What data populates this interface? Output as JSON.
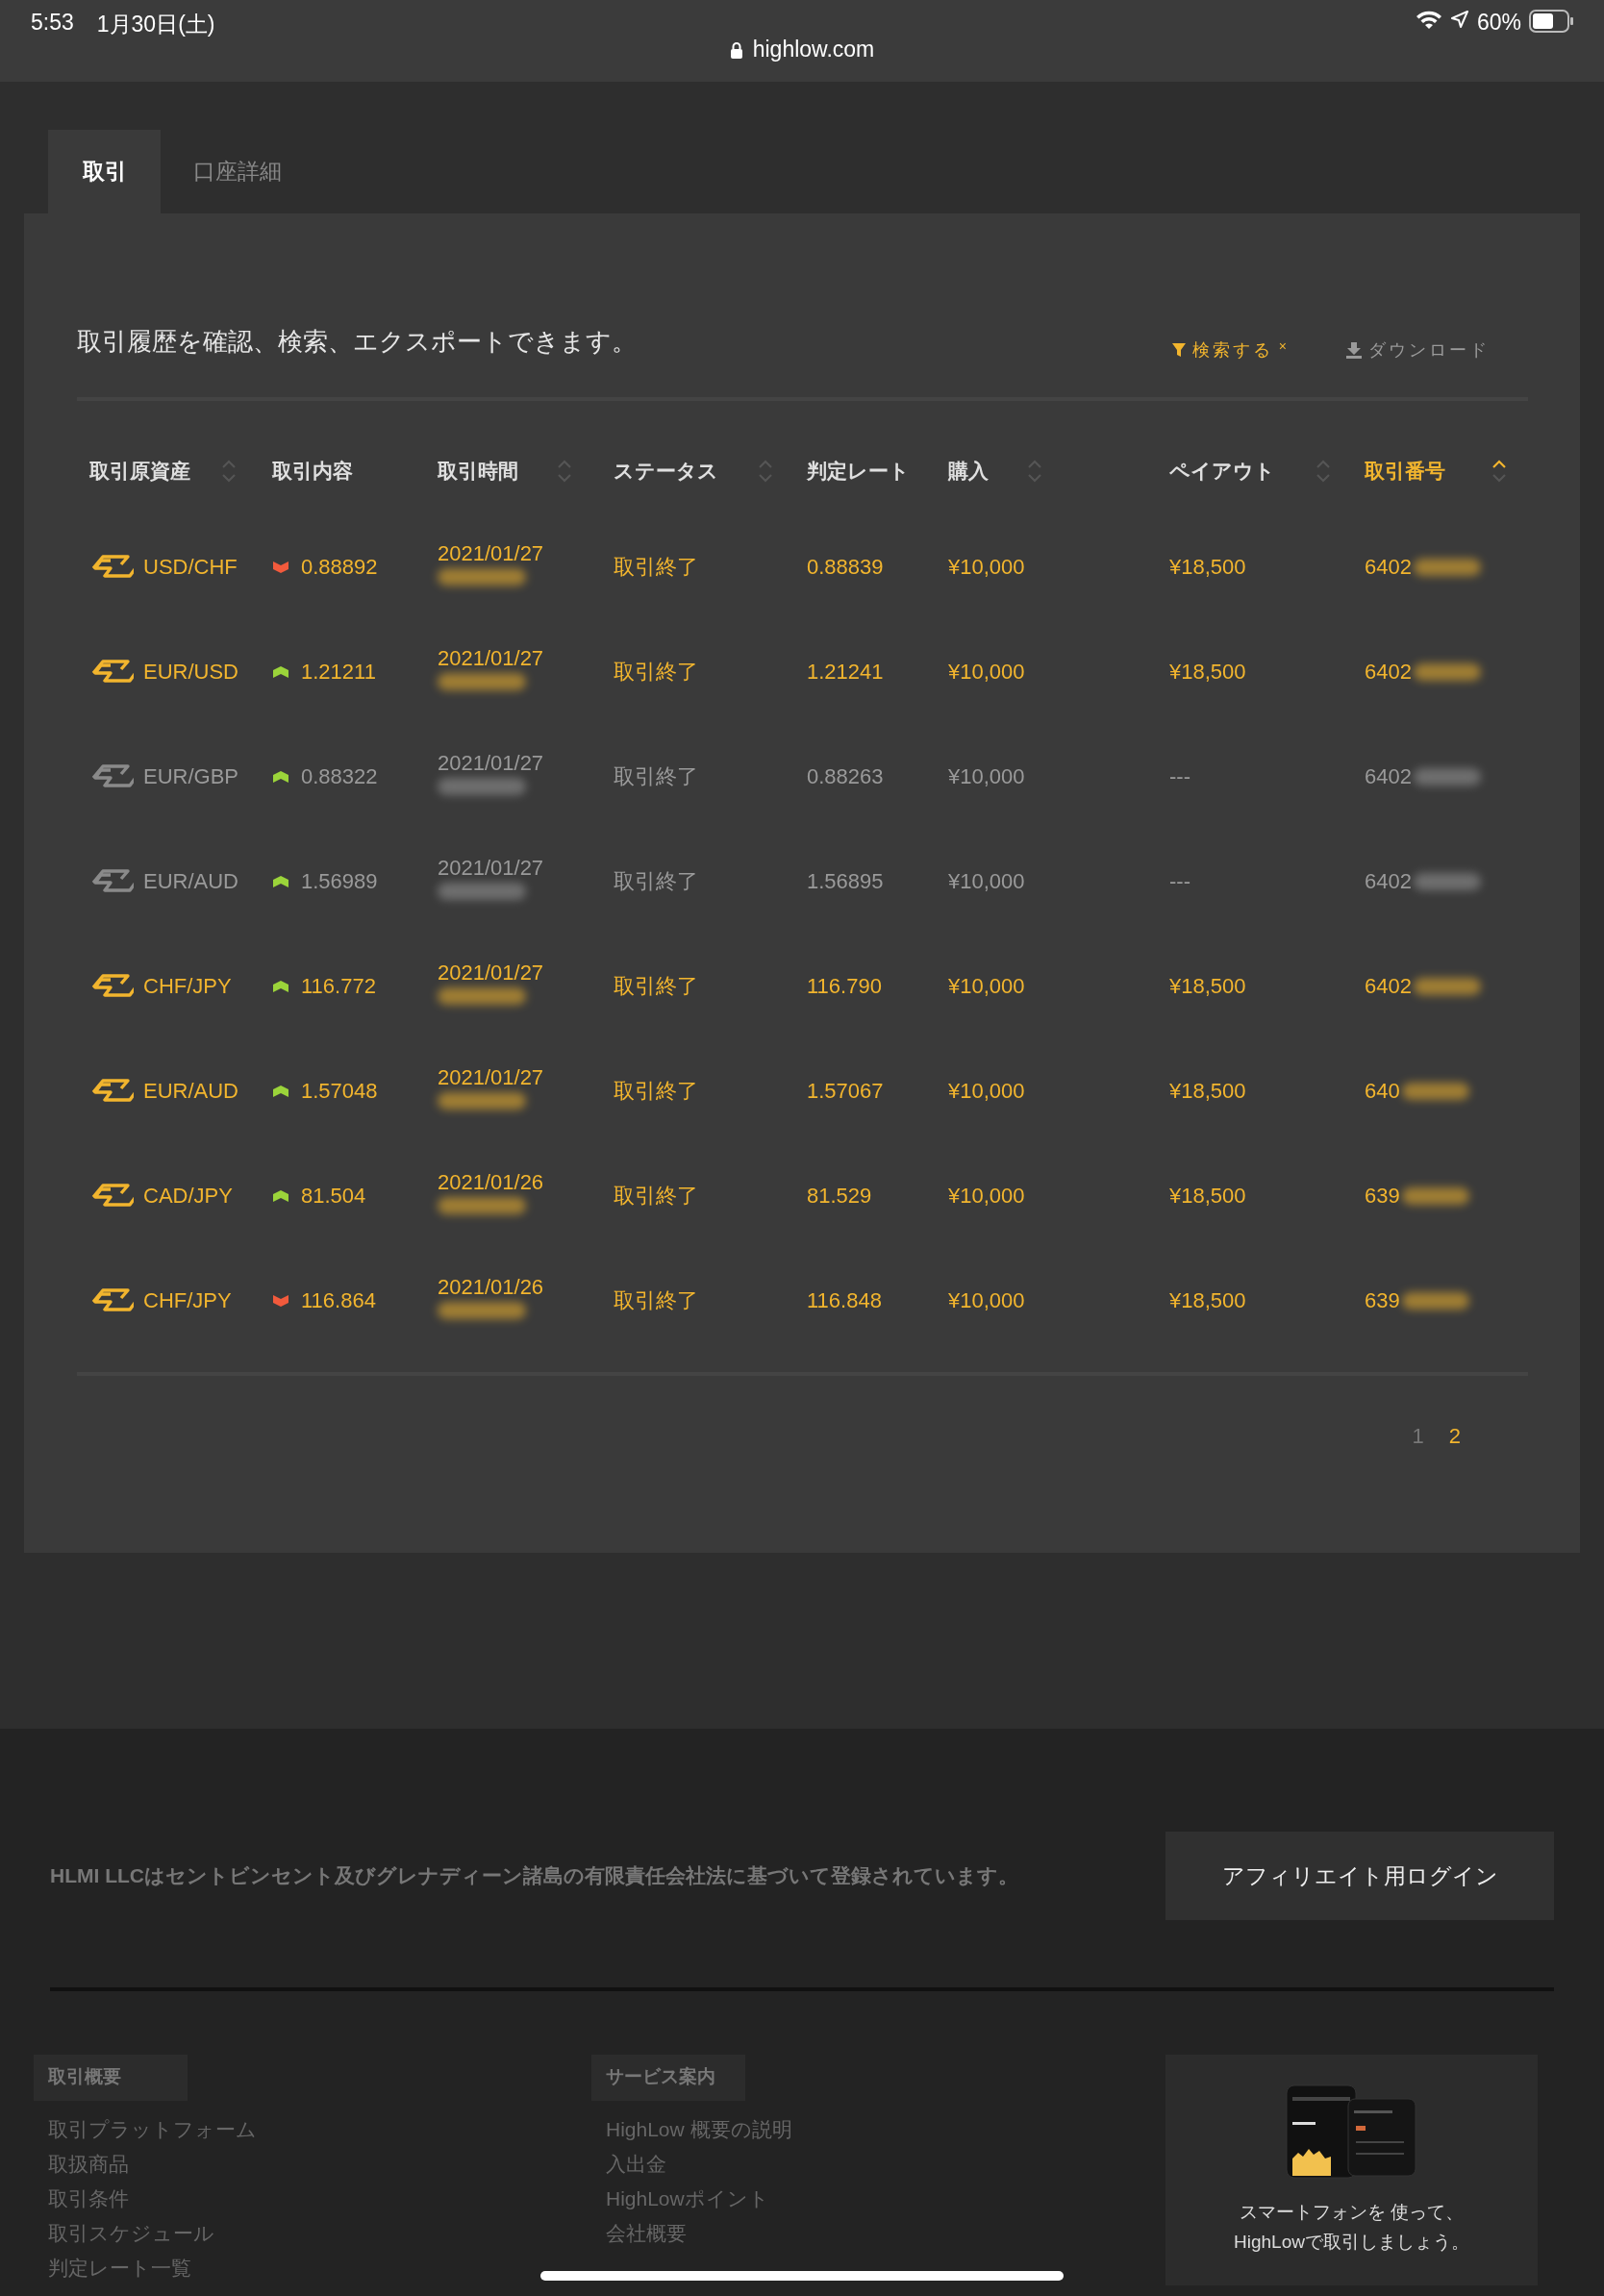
{
  "status_bar": {
    "time": "5:53",
    "date": "1月30日(土)",
    "url": "highlow.com",
    "battery": "60%"
  },
  "tabs": [
    {
      "label": "取引",
      "selected": true
    },
    {
      "label": "口座詳細",
      "selected": false
    }
  ],
  "panel": {
    "description": "取引履歴を確認、検索、エクスポートできます。",
    "actions": [
      {
        "kind": "filter",
        "label": "検索する",
        "clear": "×",
        "active": true
      },
      {
        "kind": "download",
        "label": "ダウンロード",
        "active": false
      }
    ]
  },
  "table": {
    "columns": [
      {
        "label": "取引原資産",
        "sortable": true,
        "sorted": false
      },
      {
        "label": "取引内容",
        "sortable": false,
        "sorted": false
      },
      {
        "label": "取引時間",
        "sortable": true,
        "sorted": false
      },
      {
        "label": "ステータス",
        "sortable": true,
        "sorted": false
      },
      {
        "label": "判定レート",
        "sortable": false,
        "sorted": false
      },
      {
        "label": "購入",
        "sortable": true,
        "sorted": false
      },
      {
        "label": "ペイアウト",
        "sortable": true,
        "sorted": false
      },
      {
        "label": "取引番号",
        "sortable": true,
        "sorted": true
      }
    ],
    "rows": [
      {
        "asset": "USD/CHF",
        "rising": false,
        "entry": "0.88892",
        "date": "2021/01/27",
        "status": "取引終了",
        "rate": "0.88839",
        "amount": "¥10,000",
        "payout": "¥18,500",
        "number": "6402",
        "dimmed": false
      },
      {
        "asset": "EUR/USD",
        "rising": true,
        "entry": "1.21211",
        "date": "2021/01/27",
        "status": "取引終了",
        "rate": "1.21241",
        "amount": "¥10,000",
        "payout": "¥18,500",
        "number": "6402",
        "dimmed": false
      },
      {
        "asset": "EUR/GBP",
        "rising": true,
        "entry": "0.88322",
        "date": "2021/01/27",
        "status": "取引終了",
        "rate": "0.88263",
        "amount": "¥10,000",
        "payout": "---",
        "number": "6402",
        "dimmed": true
      },
      {
        "asset": "EUR/AUD",
        "rising": true,
        "entry": "1.56989",
        "date": "2021/01/27",
        "status": "取引終了",
        "rate": "1.56895",
        "amount": "¥10,000",
        "payout": "---",
        "number": "6402",
        "dimmed": true
      },
      {
        "asset": "CHF/JPY",
        "rising": true,
        "entry": "116.772",
        "date": "2021/01/27",
        "status": "取引終了",
        "rate": "116.790",
        "amount": "¥10,000",
        "payout": "¥18,500",
        "number": "6402",
        "dimmed": false
      },
      {
        "asset": "EUR/AUD",
        "rising": true,
        "entry": "1.57048",
        "date": "2021/01/27",
        "status": "取引終了",
        "rate": "1.57067",
        "amount": "¥10,000",
        "payout": "¥18,500",
        "number": "640",
        "dimmed": false
      },
      {
        "asset": "CAD/JPY",
        "rising": true,
        "entry": "81.504",
        "date": "2021/01/26",
        "status": "取引終了",
        "rate": "81.529",
        "amount": "¥10,000",
        "payout": "¥18,500",
        "number": "639",
        "dimmed": false
      },
      {
        "asset": "CHF/JPY",
        "rising": false,
        "entry": "116.864",
        "date": "2021/01/26",
        "status": "取引終了",
        "rate": "116.848",
        "amount": "¥10,000",
        "payout": "¥18,500",
        "number": "639",
        "dimmed": false
      }
    ]
  },
  "pagination": [
    {
      "label": "1",
      "selected": false
    },
    {
      "label": "2",
      "selected": true
    }
  ],
  "footer": {
    "notice": "HLMI LLCはセントビンセント及びグレナディーン諸島の有限責任会社法に基づいて登録されています。",
    "affiliate_button": "アフィリエイト用ログイン",
    "columns": [
      {
        "heading": "取引概要",
        "links": [
          "取引プラットフォーム",
          "取扱商品",
          "取引条件",
          "取引スケジュール",
          "判定レート一覧"
        ]
      },
      {
        "heading": "サービス案内",
        "links": [
          "HighLow 概要の説明",
          "入出金",
          "HighLowポイント",
          "会社概要"
        ]
      }
    ],
    "app_promo": {
      "lines": [
        "スマートフォンを 使って、",
        "HighLowで取引しましょう。"
      ]
    }
  }
}
